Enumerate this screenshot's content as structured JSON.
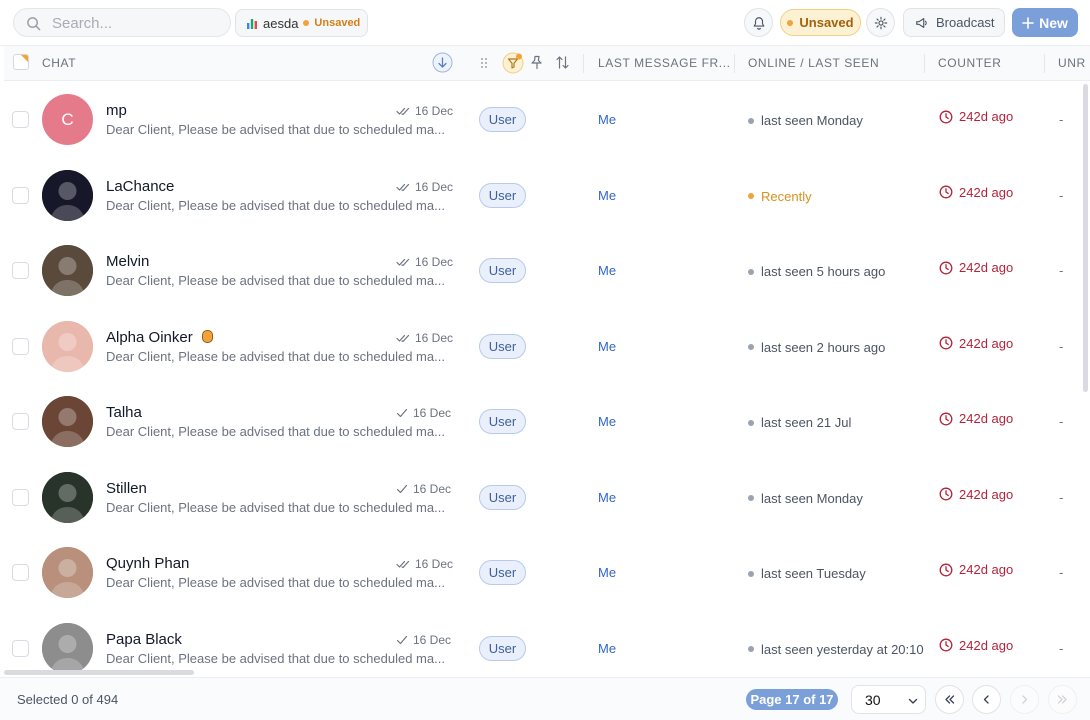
{
  "topbar": {
    "search_placeholder": "Search...",
    "list_name": "aesda",
    "list_status": "Unsaved",
    "unsaved_label": "Unsaved",
    "broadcast_label": "Broadcast",
    "new_label": "New"
  },
  "table": {
    "headers": {
      "chat": "CHAT",
      "last_message_from": "LAST MESSAGE FR...",
      "online": "ONLINE / LAST SEEN",
      "counter": "COUNTER",
      "unread": "UNR"
    },
    "rows": [
      {
        "name": "mp",
        "preview": "Dear Client, Please be advised that due to scheduled ma...",
        "date": "16 Dec",
        "read": "double",
        "role": "User",
        "last_from": "Me",
        "seen": "last seen Monday",
        "seen_status": "offline",
        "counter": "242d ago",
        "unread": "-",
        "avatar": "letter",
        "avatar_letter": "C",
        "avatar_color": "#e57a8a"
      },
      {
        "name": "LaChance",
        "preview": "Dear Client, Please be advised that due to scheduled ma...",
        "date": "16 Dec",
        "read": "double",
        "role": "User",
        "last_from": "Me",
        "seen": "Recently",
        "seen_status": "recent",
        "counter": "242d ago",
        "unread": "-",
        "avatar": "photo",
        "avatar_color": "#17172a"
      },
      {
        "name": "Melvin",
        "preview": "Dear Client, Please be advised that due to scheduled ma...",
        "date": "16 Dec",
        "read": "double",
        "role": "User",
        "last_from": "Me",
        "seen": "last seen 5 hours ago",
        "seen_status": "offline",
        "counter": "242d ago",
        "unread": "-",
        "avatar": "photo",
        "avatar_color": "#5a4a3c"
      },
      {
        "name": "Alpha Oinker",
        "preview": "Dear Client, Please be advised that due to scheduled ma...",
        "date": "16 Dec",
        "read": "double",
        "role": "User",
        "last_from": "Me",
        "seen": "last seen 2 hours ago",
        "seen_status": "offline",
        "counter": "242d ago",
        "unread": "-",
        "avatar": "photo",
        "avatar_color": "#e9b8ad",
        "badge": "emoji-badge-icon"
      },
      {
        "name": "Talha",
        "preview": "Dear Client, Please be advised that due to scheduled ma...",
        "date": "16 Dec",
        "read": "single",
        "role": "User",
        "last_from": "Me",
        "seen": "last seen 21 Jul",
        "seen_status": "offline",
        "counter": "242d ago",
        "unread": "-",
        "avatar": "photo",
        "avatar_color": "#6b4636"
      },
      {
        "name": "Stillen",
        "preview": "Dear Client, Please be advised that due to scheduled ma...",
        "date": "16 Dec",
        "read": "single",
        "role": "User",
        "last_from": "Me",
        "seen": "last seen Monday",
        "seen_status": "offline",
        "counter": "242d ago",
        "unread": "-",
        "avatar": "photo",
        "avatar_color": "#28332a"
      },
      {
        "name": "Quynh Phan",
        "preview": "Dear Client, Please be advised that due to scheduled ma...",
        "date": "16 Dec",
        "read": "double",
        "role": "User",
        "last_from": "Me",
        "seen": "last seen Tuesday",
        "seen_status": "offline",
        "counter": "242d ago",
        "unread": "-",
        "avatar": "photo",
        "avatar_color": "#b8907c"
      },
      {
        "name": "Papa Black",
        "preview": "Dear Client, Please be advised that due to scheduled ma...",
        "date": "16 Dec",
        "read": "single",
        "role": "User",
        "last_from": "Me",
        "seen": "last seen yesterday at 20:10",
        "seen_status": "offline",
        "counter": "242d ago",
        "unread": "-",
        "avatar": "photo",
        "avatar_color": "#8d8d8d"
      }
    ]
  },
  "footer": {
    "selected": "Selected 0 of 494",
    "page": "Page 17 of 17",
    "page_size": "30"
  }
}
